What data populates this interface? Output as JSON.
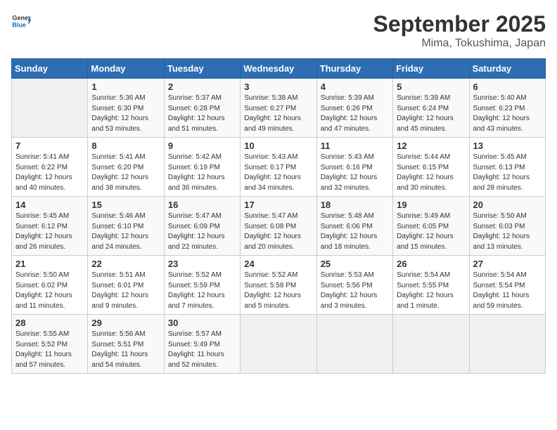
{
  "header": {
    "logo_general": "General",
    "logo_blue": "Blue",
    "month": "September 2025",
    "location": "Mima, Tokushima, Japan"
  },
  "weekdays": [
    "Sunday",
    "Monday",
    "Tuesday",
    "Wednesday",
    "Thursday",
    "Friday",
    "Saturday"
  ],
  "weeks": [
    [
      {
        "day": "",
        "empty": true
      },
      {
        "day": "1",
        "sunrise": "5:36 AM",
        "sunset": "6:30 PM",
        "daylight": "12 hours and 53 minutes."
      },
      {
        "day": "2",
        "sunrise": "5:37 AM",
        "sunset": "6:28 PM",
        "daylight": "12 hours and 51 minutes."
      },
      {
        "day": "3",
        "sunrise": "5:38 AM",
        "sunset": "6:27 PM",
        "daylight": "12 hours and 49 minutes."
      },
      {
        "day": "4",
        "sunrise": "5:39 AM",
        "sunset": "6:26 PM",
        "daylight": "12 hours and 47 minutes."
      },
      {
        "day": "5",
        "sunrise": "5:39 AM",
        "sunset": "6:24 PM",
        "daylight": "12 hours and 45 minutes."
      },
      {
        "day": "6",
        "sunrise": "5:40 AM",
        "sunset": "6:23 PM",
        "daylight": "12 hours and 43 minutes."
      }
    ],
    [
      {
        "day": "7",
        "sunrise": "5:41 AM",
        "sunset": "6:22 PM",
        "daylight": "12 hours and 40 minutes."
      },
      {
        "day": "8",
        "sunrise": "5:41 AM",
        "sunset": "6:20 PM",
        "daylight": "12 hours and 38 minutes."
      },
      {
        "day": "9",
        "sunrise": "5:42 AM",
        "sunset": "6:19 PM",
        "daylight": "12 hours and 36 minutes."
      },
      {
        "day": "10",
        "sunrise": "5:43 AM",
        "sunset": "6:17 PM",
        "daylight": "12 hours and 34 minutes."
      },
      {
        "day": "11",
        "sunrise": "5:43 AM",
        "sunset": "6:16 PM",
        "daylight": "12 hours and 32 minutes."
      },
      {
        "day": "12",
        "sunrise": "5:44 AM",
        "sunset": "6:15 PM",
        "daylight": "12 hours and 30 minutes."
      },
      {
        "day": "13",
        "sunrise": "5:45 AM",
        "sunset": "6:13 PM",
        "daylight": "12 hours and 28 minutes."
      }
    ],
    [
      {
        "day": "14",
        "sunrise": "5:45 AM",
        "sunset": "6:12 PM",
        "daylight": "12 hours and 26 minutes."
      },
      {
        "day": "15",
        "sunrise": "5:46 AM",
        "sunset": "6:10 PM",
        "daylight": "12 hours and 24 minutes."
      },
      {
        "day": "16",
        "sunrise": "5:47 AM",
        "sunset": "6:09 PM",
        "daylight": "12 hours and 22 minutes."
      },
      {
        "day": "17",
        "sunrise": "5:47 AM",
        "sunset": "6:08 PM",
        "daylight": "12 hours and 20 minutes."
      },
      {
        "day": "18",
        "sunrise": "5:48 AM",
        "sunset": "6:06 PM",
        "daylight": "12 hours and 18 minutes."
      },
      {
        "day": "19",
        "sunrise": "5:49 AM",
        "sunset": "6:05 PM",
        "daylight": "12 hours and 15 minutes."
      },
      {
        "day": "20",
        "sunrise": "5:50 AM",
        "sunset": "6:03 PM",
        "daylight": "12 hours and 13 minutes."
      }
    ],
    [
      {
        "day": "21",
        "sunrise": "5:50 AM",
        "sunset": "6:02 PM",
        "daylight": "12 hours and 11 minutes."
      },
      {
        "day": "22",
        "sunrise": "5:51 AM",
        "sunset": "6:01 PM",
        "daylight": "12 hours and 9 minutes."
      },
      {
        "day": "23",
        "sunrise": "5:52 AM",
        "sunset": "5:59 PM",
        "daylight": "12 hours and 7 minutes."
      },
      {
        "day": "24",
        "sunrise": "5:52 AM",
        "sunset": "5:58 PM",
        "daylight": "12 hours and 5 minutes."
      },
      {
        "day": "25",
        "sunrise": "5:53 AM",
        "sunset": "5:56 PM",
        "daylight": "12 hours and 3 minutes."
      },
      {
        "day": "26",
        "sunrise": "5:54 AM",
        "sunset": "5:55 PM",
        "daylight": "12 hours and 1 minute."
      },
      {
        "day": "27",
        "sunrise": "5:54 AM",
        "sunset": "5:54 PM",
        "daylight": "11 hours and 59 minutes."
      }
    ],
    [
      {
        "day": "28",
        "sunrise": "5:55 AM",
        "sunset": "5:52 PM",
        "daylight": "11 hours and 57 minutes."
      },
      {
        "day": "29",
        "sunrise": "5:56 AM",
        "sunset": "5:51 PM",
        "daylight": "11 hours and 54 minutes."
      },
      {
        "day": "30",
        "sunrise": "5:57 AM",
        "sunset": "5:49 PM",
        "daylight": "11 hours and 52 minutes."
      },
      {
        "day": "",
        "empty": true
      },
      {
        "day": "",
        "empty": true
      },
      {
        "day": "",
        "empty": true
      },
      {
        "day": "",
        "empty": true
      }
    ]
  ]
}
